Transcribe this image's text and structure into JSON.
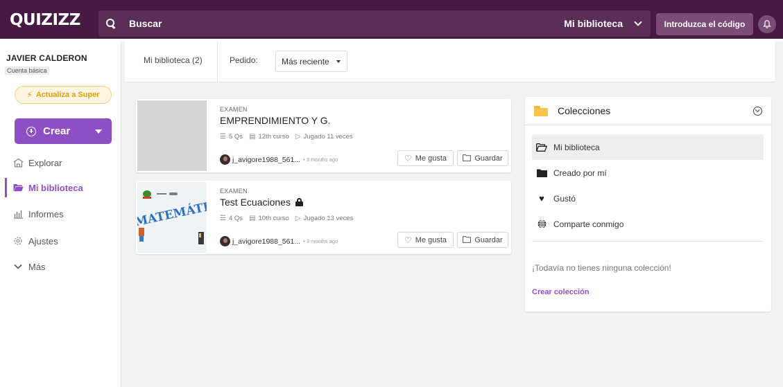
{
  "header": {
    "logo_text": "QUIZIZZ",
    "search_placeholder": "Buscar",
    "search_scope": "Mi biblioteca",
    "join_code_label": "Introduzca el código"
  },
  "sidebar": {
    "user_name": "JAVIER CALDERON",
    "plan": "Cuenta básica",
    "upgrade_label": "Actualiza a Super",
    "create_label": "Crear",
    "nav": [
      {
        "label": "Explorar",
        "icon": "explore-icon"
      },
      {
        "label": "Mi biblioteca",
        "icon": "folder-icon"
      },
      {
        "label": "Informes",
        "icon": "reports-icon"
      },
      {
        "label": "Ajustes",
        "icon": "settings-icon"
      },
      {
        "label": "Más",
        "icon": "chevron-down-icon"
      }
    ]
  },
  "filters": {
    "library_tab": "Mi biblioteca (2)",
    "order_label": "Pedido:",
    "order_value": "Más reciente"
  },
  "quizzes": [
    {
      "kind": "EXAMEN",
      "title": "EMPRENDIMIENTO Y G.",
      "questions": "5 Qs",
      "grade": "12th curso",
      "plays": "Jugado 11 veces",
      "author": "j_avigore1988_561...",
      "ago": "• 3 months ago",
      "like_label": "Me gusta",
      "save_label": "Guardar"
    },
    {
      "kind": "EXAMEN",
      "title": "Test Ecuaciones",
      "questions": "4 Qs",
      "grade": "10th curso",
      "plays": "Jugado 13 veces",
      "author": "j_avigore1988_561...",
      "ago": "• 3 months ago",
      "like_label": "Me gusta",
      "save_label": "Guardar",
      "thumbnail_text": "MATEMÁTIC"
    }
  ],
  "collections": {
    "title": "Colecciones",
    "items": [
      {
        "label": "Mi biblioteca",
        "icon": "folder-open-icon"
      },
      {
        "label": "Creado por mí",
        "icon": "folder-icon"
      },
      {
        "label": "Gustó",
        "icon": "heart-icon"
      },
      {
        "label": "Comparte conmigo",
        "icon": "globe-icon"
      }
    ],
    "empty_message": "¡Todavía no tienes ninguna colección!",
    "create_label": "Crear colección"
  },
  "colors": {
    "header_bg": "#461a42",
    "accent": "#8e4fc4",
    "upgrade": "#e09b06"
  }
}
